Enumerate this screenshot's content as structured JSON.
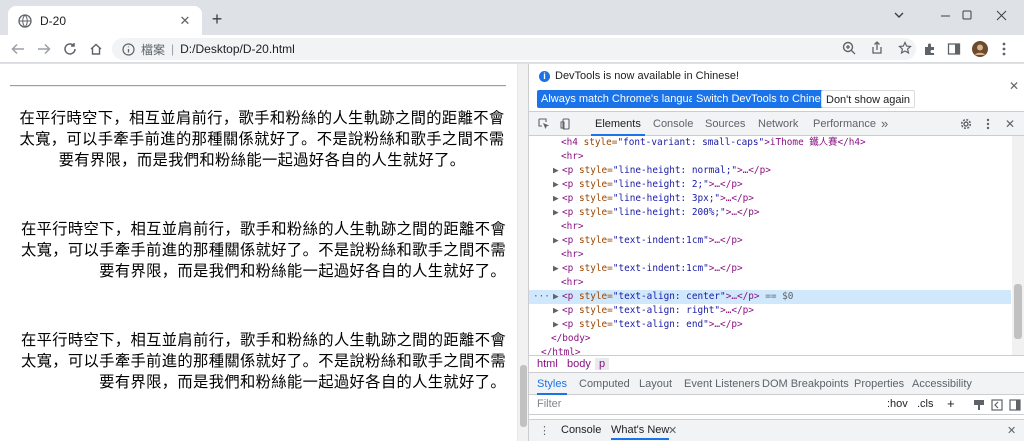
{
  "tab": {
    "title": "D-20"
  },
  "address": {
    "scheme_label": "檔案",
    "url": "D:/Desktop/D-20.html"
  },
  "page": {
    "paragraph_center": "在平行時空下，相互並肩前行，歌手和粉絲的人生軌跡之間的距離不會太寬，可以手牽手前進的那種關係就好了。不是說粉絲和歌手之間不需要有界限，而是我們和粉絲能一起過好各自的人生就好了。",
    "paragraph_right": "在平行時空下，相互並肩前行，歌手和粉絲的人生軌跡之間的距離不會太寬，可以手牽手前進的那種關係就好了。不是說粉絲和歌手之間不需要有界限，而是我們和粉絲能一起過好各自的人生就好了。",
    "paragraph_end": "在平行時空下，相互並肩前行，歌手和粉絲的人生軌跡之間的距離不會太寬，可以手牽手前進的那種關係就好了。不是說粉絲和歌手之間不需要有界限，而是我們和粉絲能一起過好各自的人生就好了。"
  },
  "devtools": {
    "notice": {
      "message": "DevTools is now available in Chinese!",
      "btn_match": "Always match Chrome's language",
      "btn_switch": "Switch DevTools to Chinese",
      "btn_dismiss": "Don't show again"
    },
    "tabs": [
      "Elements",
      "Console",
      "Sources",
      "Network",
      "Performance",
      "»"
    ],
    "dom": {
      "h4_open": "<h4 ",
      "h4_attr": "style=",
      "h4_val": "\"font-variant: small-caps\"",
      "h4_text": ">iThome 鐵人賽</h4>",
      "hr": "<hr>",
      "p_open": "<p ",
      "attr": "style=",
      "p_close": ">…</p>",
      "rows": [
        "\"line-height: normal;\"",
        "\"line-height: 2;\"",
        "\"line-height: 3px;\"",
        "\"line-height: 200%;\"",
        "\"text-indent:1cm\"",
        "\"text-indent:1cm\"",
        "\"text-align: center\"",
        "\"text-align: right\"",
        "\"text-align: end\""
      ],
      "selected_suffix": " == $0",
      "dots": "···",
      "body_close": "</body>",
      "html_close": "</html>"
    },
    "breadcrumb": [
      "html",
      "body",
      "p"
    ],
    "style_tabs": [
      "Styles",
      "Computed",
      "Layout",
      "Event Listeners",
      "DOM Breakpoints",
      "Properties",
      "Accessibility"
    ],
    "filter": {
      "placeholder": "Filter",
      "hov": ":hov",
      "cls": ".cls",
      "plus": "+"
    },
    "drawer": {
      "console": "Console",
      "whatsnew": "What's New"
    }
  },
  "colors": {
    "accent": "#1a73e8",
    "selected_row": "#cfe8fc"
  }
}
